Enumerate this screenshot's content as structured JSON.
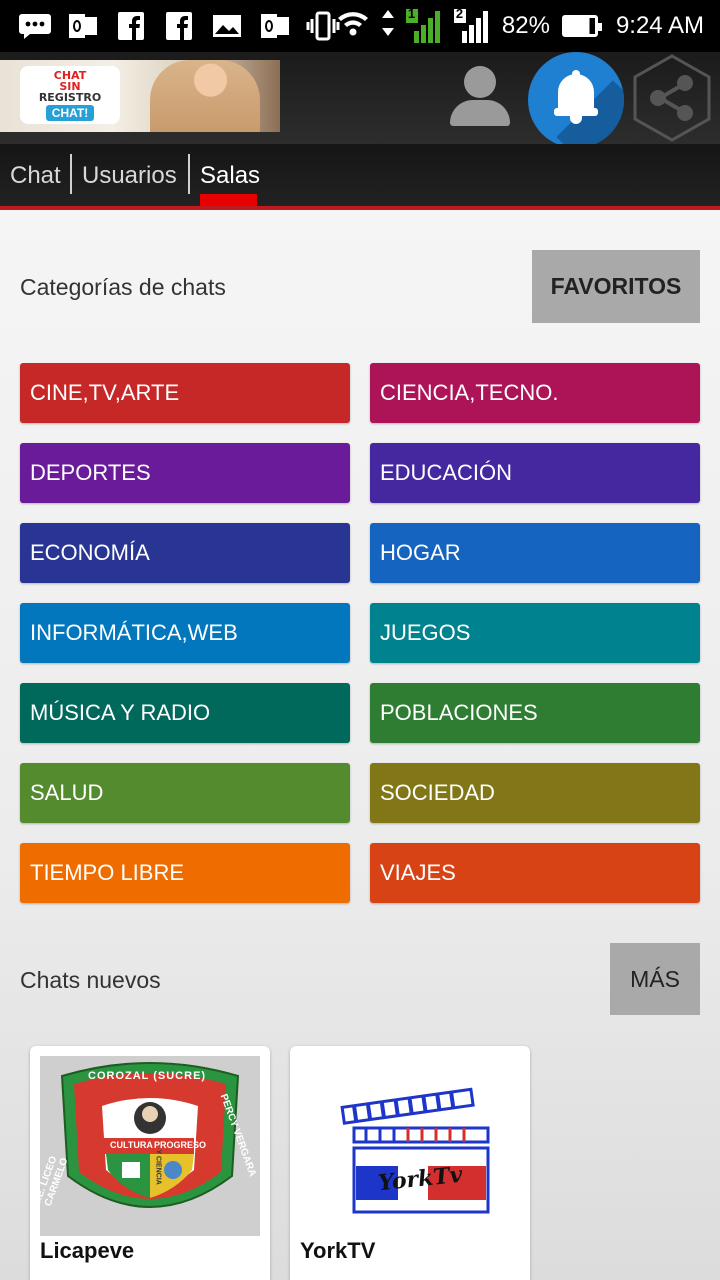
{
  "status_bar": {
    "icons": [
      "chat-bubble-icon",
      "outlook-icon",
      "facebook-icon",
      "facebook-icon",
      "image-icon",
      "outlook-icon",
      "vibrate-icon",
      "wifi-icon",
      "signal-sim1-icon",
      "signal-sim2-icon"
    ],
    "sim1": "1",
    "sim2": "2",
    "battery": "82%",
    "time": "9:24 AM"
  },
  "header": {
    "banner": {
      "line1": "CHAT",
      "line2": "SIN",
      "line3": "REGISTRO",
      "cta": "CHAT!"
    },
    "icons": [
      "user-avatar-icon",
      "bell-icon",
      "share-icon"
    ],
    "accent": "#1f7fd0"
  },
  "tabs": [
    {
      "label": "Chat"
    },
    {
      "label": "Usuarios"
    },
    {
      "label": "Salas"
    }
  ],
  "active_tab": "Salas",
  "categories_section": {
    "title": "Categorías de chats",
    "favorites_label": "FAVORITOS",
    "items": [
      {
        "label": "CINE,TV,ARTE",
        "color": "#c62828"
      },
      {
        "label": "CIENCIA,TECNO.",
        "color": "#ad1457"
      },
      {
        "label": "DEPORTES",
        "color": "#6a1b9a"
      },
      {
        "label": "EDUCACIÓN",
        "color": "#4527a0"
      },
      {
        "label": "ECONOMÍA",
        "color": "#283593"
      },
      {
        "label": "HOGAR",
        "color": "#1565c0"
      },
      {
        "label": "INFORMÁTICA,WEB",
        "color": "#0277bd"
      },
      {
        "label": "JUEGOS",
        "color": "#00838f"
      },
      {
        "label": "MÚSICA Y RADIO",
        "color": "#00695c"
      },
      {
        "label": "POBLACIONES",
        "color": "#2e7d32"
      },
      {
        "label": "SALUD",
        "color": "#558b2f"
      },
      {
        "label": "SOCIEDAD",
        "color": "#827717"
      },
      {
        "label": "TIEMPO LIBRE",
        "color": "#ef6c00"
      },
      {
        "label": "VIAJES",
        "color": "#d84315"
      }
    ]
  },
  "new_chats_section": {
    "title": "Chats nuevos",
    "more_label": "MÁS",
    "items": [
      {
        "name": "Licapeve",
        "logo_text": {
          "top": "COROZAL (SUCRE)",
          "band1": "CULTURA",
          "band2": "PROGRESO",
          "ring_left": "I.E. LICEO CARMELO",
          "ring_right": "PERCY VERGARA",
          "center": "Y CIENCIA"
        }
      },
      {
        "name": "YorkTV",
        "logo_text": {
          "wordmark": "YorkTv"
        }
      }
    ]
  }
}
